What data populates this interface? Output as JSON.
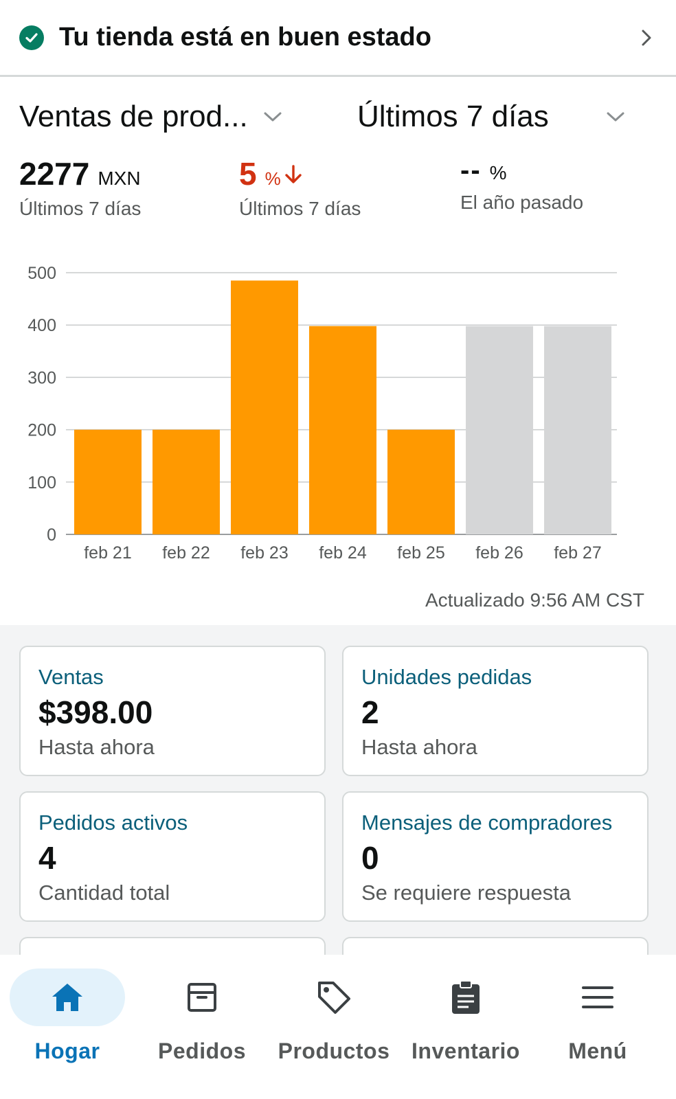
{
  "health": {
    "title": "Tu tienda está en buen estado"
  },
  "selectors": {
    "metric": "Ventas de prod...",
    "range": "Últimos 7 días"
  },
  "stats": [
    {
      "value": "2277",
      "unit": "MXN",
      "label": "Últimos 7 días"
    },
    {
      "value": "5",
      "unit": "%",
      "trend": "down",
      "label": "Últimos 7 días"
    },
    {
      "value": "--",
      "unit": "%",
      "label": "El año pasado"
    }
  ],
  "chart_data": {
    "type": "bar",
    "categories": [
      "feb 21",
      "feb 22",
      "feb 23",
      "feb 24",
      "feb 25",
      "feb 26",
      "feb 27"
    ],
    "values": [
      200,
      200,
      485,
      398,
      200,
      398,
      398
    ],
    "bar_colors": [
      "#ff9900",
      "#ff9900",
      "#ff9900",
      "#ff9900",
      "#ff9900",
      "#d5d6d7",
      "#d5d6d7"
    ],
    "ylim": [
      0,
      500
    ],
    "yticks": [
      0,
      100,
      200,
      300,
      400,
      500
    ],
    "grid": true,
    "title": "",
    "xlabel": "",
    "ylabel": ""
  },
  "updated": "Actualizado 9:56 AM CST",
  "cards": [
    {
      "title": "Ventas",
      "value": "$398.00",
      "sub": "Hasta ahora"
    },
    {
      "title": "Unidades pedidas",
      "value": "2",
      "sub": "Hasta ahora"
    },
    {
      "title": "Pedidos activos",
      "value": "4",
      "sub": "Cantidad total"
    },
    {
      "title": "Mensajes de compradores",
      "value": "0",
      "sub": "Se requiere respuesta"
    }
  ],
  "nav": [
    {
      "label": "Hogar",
      "icon": "home-icon",
      "active": true
    },
    {
      "label": "Pedidos",
      "icon": "box-icon",
      "active": false
    },
    {
      "label": "Productos",
      "icon": "tag-icon",
      "active": false
    },
    {
      "label": "Inventario",
      "icon": "clipboard-icon",
      "active": false
    },
    {
      "label": "Menú",
      "icon": "menu-icon",
      "active": false
    }
  ],
  "colors": {
    "accent": "#ff9900",
    "future_bar": "#d5d6d7",
    "success": "#067d62",
    "negative": "#d13212",
    "link": "#0b5f7a",
    "nav_active": "#0a73b6"
  }
}
